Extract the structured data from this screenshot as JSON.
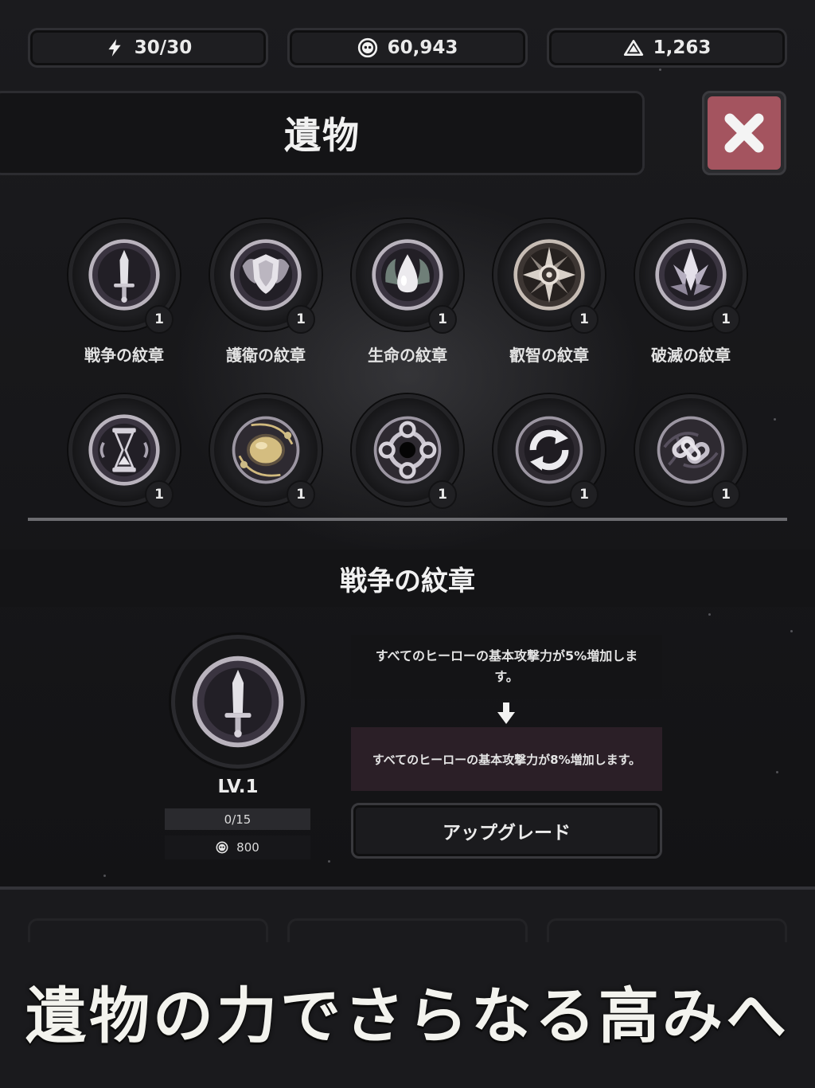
{
  "resources": {
    "energy": "30/30",
    "coins": "60,943",
    "gems": "1,263"
  },
  "header": {
    "title": "遺物"
  },
  "relics": [
    {
      "name": "戦争の紋章",
      "count": "1",
      "icon": "sword-emblem-icon"
    },
    {
      "name": "護衛の紋章",
      "count": "1",
      "icon": "shield-emblem-icon"
    },
    {
      "name": "生命の紋章",
      "count": "1",
      "icon": "droplet-emblem-icon"
    },
    {
      "name": "叡智の紋章",
      "count": "1",
      "icon": "star-emblem-icon"
    },
    {
      "name": "破滅の紋章",
      "count": "1",
      "icon": "crystal-emblem-icon"
    },
    {
      "name": "",
      "count": "1",
      "icon": "hourglass-relic-icon"
    },
    {
      "name": "",
      "count": "1",
      "icon": "orb-relic-icon"
    },
    {
      "name": "",
      "count": "1",
      "icon": "cross-circle-relic-icon"
    },
    {
      "name": "",
      "count": "1",
      "icon": "cycle-arrows-relic-icon"
    },
    {
      "name": "",
      "count": "1",
      "icon": "chain-relic-icon"
    }
  ],
  "selected": {
    "name": "戦争の紋章",
    "level": "LV.1",
    "progress": "0/15",
    "cost": "800",
    "current_effect": "すべてのヒーローの基本攻撃力が5%増加します。",
    "next_effect": "すべてのヒーローの基本攻撃力が8%増加します。",
    "upgrade_label": "アップグレード"
  },
  "tagline": "遺物の力でさらなる高みへ",
  "colors": {
    "close_button": "#a4545f",
    "next_effect_bg": "#2b1f27",
    "background": "#151517"
  }
}
